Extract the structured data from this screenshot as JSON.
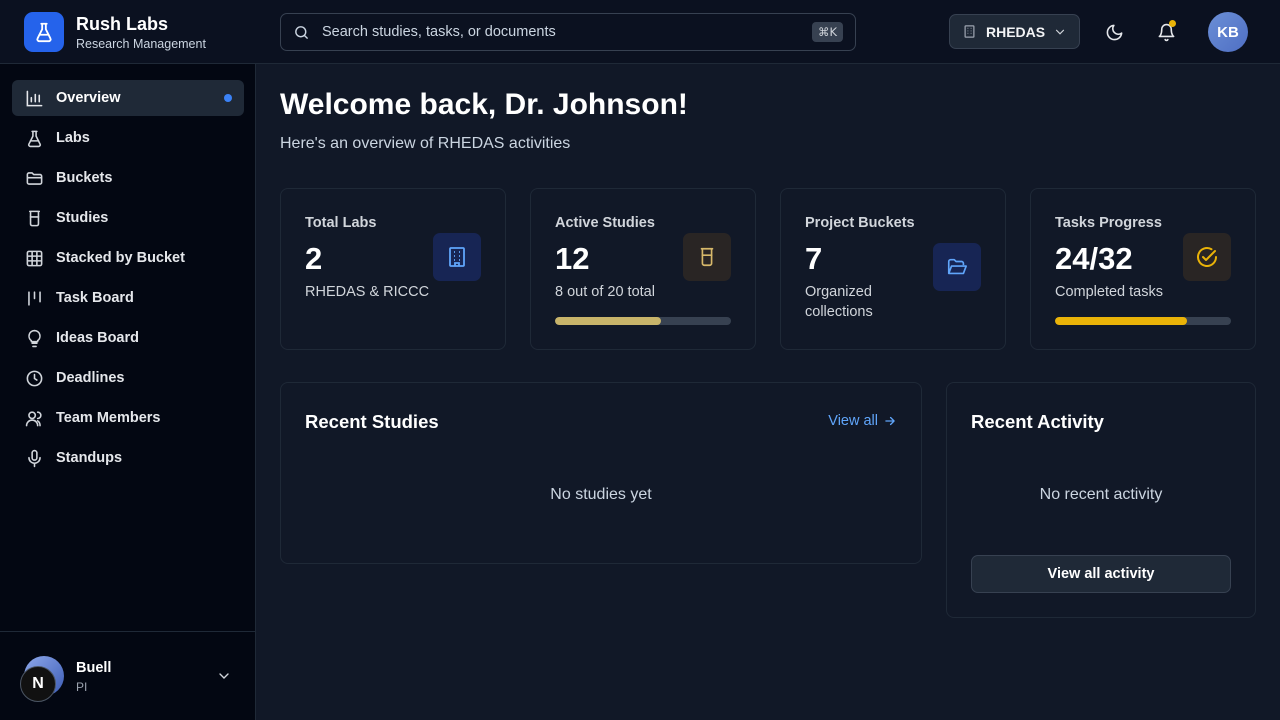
{
  "brand": {
    "title": "Rush Labs",
    "subtitle": "Research Management"
  },
  "search": {
    "placeholder": "Search studies, tasks, or documents",
    "shortcut": "⌘K"
  },
  "lab_selector": {
    "selected": "RHEDAS"
  },
  "user_avatar": {
    "initials": "KB"
  },
  "sidebar": {
    "items": [
      {
        "label": "Overview",
        "icon": "chart-icon",
        "active": true
      },
      {
        "label": "Labs",
        "icon": "flask-icon"
      },
      {
        "label": "Buckets",
        "icon": "folder-icon"
      },
      {
        "label": "Studies",
        "icon": "beaker-icon"
      },
      {
        "label": "Stacked by Bucket",
        "icon": "grid-icon"
      },
      {
        "label": "Task Board",
        "icon": "kanban-icon"
      },
      {
        "label": "Ideas Board",
        "icon": "lightbulb-icon"
      },
      {
        "label": "Deadlines",
        "icon": "clock-icon"
      },
      {
        "label": "Team Members",
        "icon": "users-icon"
      },
      {
        "label": "Standups",
        "icon": "microphone-icon"
      }
    ],
    "user": {
      "name": "Buell",
      "role": "PI",
      "badge": "N"
    }
  },
  "main": {
    "title": "Welcome back, Dr. Johnson!",
    "subtitle": "Here's an overview of RHEDAS activities",
    "stats": [
      {
        "label": "Total Labs",
        "value": "2",
        "desc": "RHEDAS & RICCC",
        "icon": "building-icon"
      },
      {
        "label": "Active Studies",
        "value": "12",
        "desc": "8 out of 20 total",
        "icon": "beaker-icon",
        "progress": 0.6
      },
      {
        "label": "Project Buckets",
        "value": "7",
        "desc": "Organized collections",
        "icon": "folder-open-icon"
      },
      {
        "label": "Tasks Progress",
        "value": "24/32",
        "desc": "Completed tasks",
        "icon": "check-circle-icon",
        "progress": 0.75
      }
    ],
    "recent_studies": {
      "title": "Recent Studies",
      "view_all": "View all",
      "empty": "No studies yet"
    },
    "recent_activity": {
      "title": "Recent Activity",
      "empty": "No recent activity",
      "button": "View all activity"
    }
  },
  "colors": {
    "accent": "#2563eb",
    "studies_progress": "#c8b46a",
    "tasks_progress": "#eab308",
    "link": "#60a5fa"
  }
}
